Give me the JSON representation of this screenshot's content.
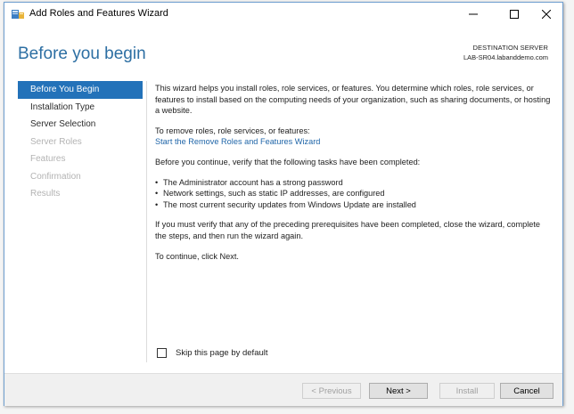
{
  "window": {
    "title": "Add Roles and Features Wizard",
    "controls": {
      "minimize": "—",
      "maximize": "☐",
      "close": "✕"
    }
  },
  "header": {
    "heading": "Before you begin",
    "destination_label": "DESTINATION SERVER",
    "destination_server": "LAB-SR04.labanddemo.com"
  },
  "nav": {
    "items": [
      {
        "label": "Before You Begin",
        "state": "active"
      },
      {
        "label": "Installation Type",
        "state": "normal"
      },
      {
        "label": "Server Selection",
        "state": "normal"
      },
      {
        "label": "Server Roles",
        "state": "disabled"
      },
      {
        "label": "Features",
        "state": "disabled"
      },
      {
        "label": "Confirmation",
        "state": "disabled"
      },
      {
        "label": "Results",
        "state": "disabled"
      }
    ]
  },
  "content": {
    "intro": "This wizard helps you install roles, role services, or features. You determine which roles, role services, or features to install based on the computing needs of your organization, such as sharing documents, or hosting a website.",
    "remove_label": "To remove roles, role services, or features:",
    "remove_link": "Start the Remove Roles and Features Wizard",
    "verify_intro": "Before you continue, verify that the following tasks have been completed:",
    "bullets": [
      "The Administrator account has a strong password",
      "Network settings, such as static IP addresses, are configured",
      "The most current security updates from Windows Update are installed"
    ],
    "bullet_glyph": "•",
    "prereq_note": "If you must verify that any of the preceding prerequisites have been completed, close the wizard, complete the steps, and then run the wizard again.",
    "continue_note": "To continue, click Next."
  },
  "skip": {
    "label": "Skip this page by default",
    "checked": false
  },
  "footer": {
    "previous": "< Previous",
    "next": "Next >",
    "install": "Install",
    "cancel": "Cancel"
  },
  "colors": {
    "accent": "#2372b9",
    "heading": "#2d6fa3",
    "link": "#1f65a8"
  }
}
